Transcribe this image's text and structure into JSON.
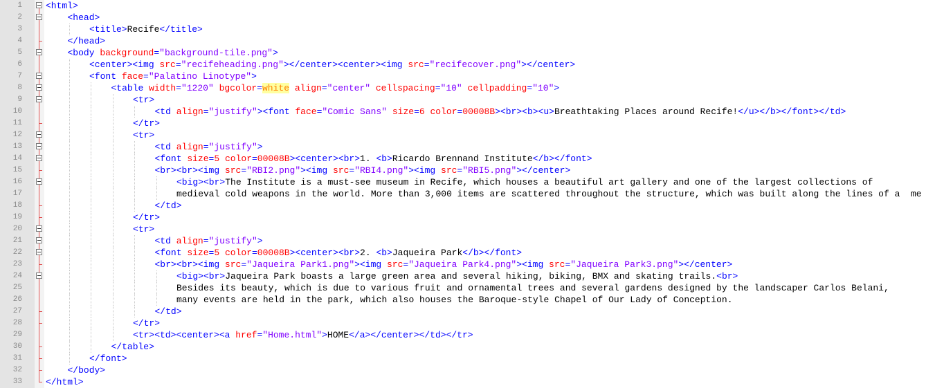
{
  "editor": {
    "colors": {
      "tag": "#0000ff",
      "attribute": "#ff0000",
      "string_value": "#8000ff",
      "unquoted_value": "#ff8000",
      "text": "#000000",
      "line_number": "#8a8a8a",
      "gutter_bg": "#e4e4e4"
    },
    "lines": [
      {
        "n": "1",
        "fold": "box-start",
        "indent": 0,
        "tokens": [
          {
            "t": "<html>",
            "c": "tg"
          }
        ]
      },
      {
        "n": "2",
        "fold": "box",
        "indent": 1,
        "tokens": [
          {
            "t": "<head>",
            "c": "tg"
          }
        ]
      },
      {
        "n": "3",
        "fold": "line",
        "indent": 2,
        "tokens": [
          {
            "t": "<title>",
            "c": "tg"
          },
          {
            "t": "Recife",
            "c": "tx"
          },
          {
            "t": "</title>",
            "c": "tg"
          }
        ]
      },
      {
        "n": "4",
        "fold": "tick",
        "indent": 1,
        "tokens": [
          {
            "t": "</head>",
            "c": "tg"
          }
        ]
      },
      {
        "n": "5",
        "fold": "box",
        "indent": 1,
        "tokens": [
          {
            "t": "<body ",
            "c": "tg"
          },
          {
            "t": "background",
            "c": "at"
          },
          {
            "t": "=",
            "c": "tg"
          },
          {
            "t": "\"background-tile.png\"",
            "c": "sv"
          },
          {
            "t": ">",
            "c": "tg"
          }
        ]
      },
      {
        "n": "6",
        "fold": "line",
        "indent": 2,
        "tokens": [
          {
            "t": "<center><img ",
            "c": "tg"
          },
          {
            "t": "src",
            "c": "at"
          },
          {
            "t": "=",
            "c": "tg"
          },
          {
            "t": "\"recifeheading.png\"",
            "c": "sv"
          },
          {
            "t": "></center><center><img ",
            "c": "tg"
          },
          {
            "t": "src",
            "c": "at"
          },
          {
            "t": "=",
            "c": "tg"
          },
          {
            "t": "\"recifecover.png\"",
            "c": "sv"
          },
          {
            "t": "></center>",
            "c": "tg"
          }
        ]
      },
      {
        "n": "7",
        "fold": "box",
        "indent": 2,
        "tokens": [
          {
            "t": "<font ",
            "c": "tg"
          },
          {
            "t": "face",
            "c": "at"
          },
          {
            "t": "=",
            "c": "tg"
          },
          {
            "t": "\"Palatino Linotype\"",
            "c": "sv"
          },
          {
            "t": ">",
            "c": "tg"
          }
        ]
      },
      {
        "n": "8",
        "fold": "box",
        "indent": 3,
        "tokens": [
          {
            "t": "<table ",
            "c": "tg"
          },
          {
            "t": "width",
            "c": "at"
          },
          {
            "t": "=",
            "c": "tg"
          },
          {
            "t": "\"1220\"",
            "c": "sv"
          },
          {
            "t": " ",
            "c": "tx"
          },
          {
            "t": "bgcolor",
            "c": "at"
          },
          {
            "t": "=",
            "c": "tg"
          },
          {
            "t": "white",
            "c": "ut"
          },
          {
            "t": " ",
            "c": "tx"
          },
          {
            "t": "align",
            "c": "at"
          },
          {
            "t": "=",
            "c": "tg"
          },
          {
            "t": "\"center\"",
            "c": "sv"
          },
          {
            "t": " ",
            "c": "tx"
          },
          {
            "t": "cellspacing",
            "c": "at"
          },
          {
            "t": "=",
            "c": "tg"
          },
          {
            "t": "\"10\"",
            "c": "sv"
          },
          {
            "t": " ",
            "c": "tx"
          },
          {
            "t": "cellpadding",
            "c": "at"
          },
          {
            "t": "=",
            "c": "tg"
          },
          {
            "t": "\"10\"",
            "c": "sv"
          },
          {
            "t": ">",
            "c": "tg"
          }
        ]
      },
      {
        "n": "9",
        "fold": "box",
        "indent": 4,
        "tokens": [
          {
            "t": "<tr>",
            "c": "tg"
          }
        ]
      },
      {
        "n": "10",
        "fold": "line",
        "indent": 5,
        "tokens": [
          {
            "t": "<td ",
            "c": "tg"
          },
          {
            "t": "align",
            "c": "at"
          },
          {
            "t": "=",
            "c": "tg"
          },
          {
            "t": "\"justify\"",
            "c": "sv"
          },
          {
            "t": "><font ",
            "c": "tg"
          },
          {
            "t": "face",
            "c": "at"
          },
          {
            "t": "=",
            "c": "tg"
          },
          {
            "t": "\"Comic Sans\"",
            "c": "sv"
          },
          {
            "t": " ",
            "c": "tx"
          },
          {
            "t": "size",
            "c": "at"
          },
          {
            "t": "=",
            "c": "tg"
          },
          {
            "t": "6",
            "c": "nm"
          },
          {
            "t": " ",
            "c": "tx"
          },
          {
            "t": "color",
            "c": "at"
          },
          {
            "t": "=",
            "c": "tg"
          },
          {
            "t": "00008B",
            "c": "nm"
          },
          {
            "t": "><br><b><u>",
            "c": "tg"
          },
          {
            "t": "Breathtaking Places around Recife!",
            "c": "tx"
          },
          {
            "t": "</u></b></font></td>",
            "c": "tg"
          }
        ]
      },
      {
        "n": "11",
        "fold": "tick",
        "indent": 4,
        "tokens": [
          {
            "t": "</tr>",
            "c": "tg"
          }
        ]
      },
      {
        "n": "12",
        "fold": "box",
        "indent": 4,
        "tokens": [
          {
            "t": "<tr>",
            "c": "tg"
          }
        ]
      },
      {
        "n": "13",
        "fold": "box",
        "indent": 5,
        "tokens": [
          {
            "t": "<td ",
            "c": "tg"
          },
          {
            "t": "align",
            "c": "at"
          },
          {
            "t": "=",
            "c": "tg"
          },
          {
            "t": "\"justify\"",
            "c": "sv"
          },
          {
            "t": ">",
            "c": "tg"
          }
        ]
      },
      {
        "n": "14",
        "fold": "box",
        "indent": 5,
        "tokens": [
          {
            "t": "<font ",
            "c": "tg"
          },
          {
            "t": "size",
            "c": "at"
          },
          {
            "t": "=",
            "c": "tg"
          },
          {
            "t": "5",
            "c": "nm"
          },
          {
            "t": " ",
            "c": "tx"
          },
          {
            "t": "color",
            "c": "at"
          },
          {
            "t": "=",
            "c": "tg"
          },
          {
            "t": "00008B",
            "c": "nm"
          },
          {
            "t": "><center><br>",
            "c": "tg"
          },
          {
            "t": "1. ",
            "c": "tx"
          },
          {
            "t": "<b>",
            "c": "tg"
          },
          {
            "t": "Ricardo Brennand Institute",
            "c": "tx"
          },
          {
            "t": "</b></font>",
            "c": "tg"
          }
        ]
      },
      {
        "n": "15",
        "fold": "tick",
        "indent": 5,
        "tokens": [
          {
            "t": "<br><br><img ",
            "c": "tg"
          },
          {
            "t": "src",
            "c": "at"
          },
          {
            "t": "=",
            "c": "tg"
          },
          {
            "t": "\"RBI2.png\"",
            "c": "sv"
          },
          {
            "t": "><img ",
            "c": "tg"
          },
          {
            "t": "src",
            "c": "at"
          },
          {
            "t": "=",
            "c": "tg"
          },
          {
            "t": "\"RBI4.png\"",
            "c": "sv"
          },
          {
            "t": "><img ",
            "c": "tg"
          },
          {
            "t": "src",
            "c": "at"
          },
          {
            "t": "=",
            "c": "tg"
          },
          {
            "t": "\"RBI5.png\"",
            "c": "sv"
          },
          {
            "t": "></center>",
            "c": "tg"
          }
        ]
      },
      {
        "n": "16",
        "fold": "box",
        "indent": 6,
        "tokens": [
          {
            "t": "<big><br>",
            "c": "tg"
          },
          {
            "t": "The Institute is a must-see museum in Recife, which houses a beautiful art gallery and one of the largest collections of",
            "c": "tx"
          }
        ]
      },
      {
        "n": "17",
        "fold": "line",
        "indent": 6,
        "tokens": [
          {
            "t": "medieval cold weapons in the world. More than 3,000 items are scattered throughout the structure, which was built along the lines of a  me",
            "c": "tx"
          }
        ]
      },
      {
        "n": "18",
        "fold": "tick",
        "indent": 5,
        "tokens": [
          {
            "t": "</td>",
            "c": "tg"
          }
        ]
      },
      {
        "n": "19",
        "fold": "tick",
        "indent": 4,
        "tokens": [
          {
            "t": "</tr>",
            "c": "tg"
          }
        ]
      },
      {
        "n": "20",
        "fold": "box",
        "indent": 4,
        "tokens": [
          {
            "t": "<tr>",
            "c": "tg"
          }
        ]
      },
      {
        "n": "21",
        "fold": "box",
        "indent": 5,
        "tokens": [
          {
            "t": "<td ",
            "c": "tg"
          },
          {
            "t": "align",
            "c": "at"
          },
          {
            "t": "=",
            "c": "tg"
          },
          {
            "t": "\"justify\"",
            "c": "sv"
          },
          {
            "t": ">",
            "c": "tg"
          }
        ]
      },
      {
        "n": "22",
        "fold": "box",
        "indent": 5,
        "tokens": [
          {
            "t": "<font ",
            "c": "tg"
          },
          {
            "t": "size",
            "c": "at"
          },
          {
            "t": "=",
            "c": "tg"
          },
          {
            "t": "5",
            "c": "nm"
          },
          {
            "t": " ",
            "c": "tx"
          },
          {
            "t": "color",
            "c": "at"
          },
          {
            "t": "=",
            "c": "tg"
          },
          {
            "t": "00008B",
            "c": "nm"
          },
          {
            "t": "><center><br>",
            "c": "tg"
          },
          {
            "t": "2. ",
            "c": "tx"
          },
          {
            "t": "<b>",
            "c": "tg"
          },
          {
            "t": "Jaqueira Park",
            "c": "tx"
          },
          {
            "t": "</b></font>",
            "c": "tg"
          }
        ]
      },
      {
        "n": "23",
        "fold": "tick",
        "indent": 5,
        "tokens": [
          {
            "t": "<br><br><img ",
            "c": "tg"
          },
          {
            "t": "src",
            "c": "at"
          },
          {
            "t": "=",
            "c": "tg"
          },
          {
            "t": "\"Jaqueira Park1.png\"",
            "c": "sv"
          },
          {
            "t": "><img ",
            "c": "tg"
          },
          {
            "t": "src",
            "c": "at"
          },
          {
            "t": "=",
            "c": "tg"
          },
          {
            "t": "\"Jaqueira Park4.png\"",
            "c": "sv"
          },
          {
            "t": "><img ",
            "c": "tg"
          },
          {
            "t": "src",
            "c": "at"
          },
          {
            "t": "=",
            "c": "tg"
          },
          {
            "t": "\"Jaqueira Park3.png\"",
            "c": "sv"
          },
          {
            "t": "></center>",
            "c": "tg"
          }
        ]
      },
      {
        "n": "24",
        "fold": "box",
        "indent": 6,
        "tokens": [
          {
            "t": "<big><br>",
            "c": "tg"
          },
          {
            "t": "Jaqueira Park boasts a large green area and several hiking, biking, BMX and skating trails.",
            "c": "tx"
          },
          {
            "t": "<br>",
            "c": "tg"
          }
        ]
      },
      {
        "n": "25",
        "fold": "line",
        "indent": 6,
        "tokens": [
          {
            "t": "Besides its beauty, which is due to various fruit and ornamental trees and several gardens designed by the landscaper Carlos Belani,",
            "c": "tx"
          }
        ]
      },
      {
        "n": "26",
        "fold": "line",
        "indent": 6,
        "tokens": [
          {
            "t": "many events are held in the park, which also houses the Baroque-style Chapel of Our Lady of Conception.",
            "c": "tx"
          }
        ]
      },
      {
        "n": "27",
        "fold": "tick",
        "indent": 5,
        "tokens": [
          {
            "t": "</td>",
            "c": "tg"
          }
        ]
      },
      {
        "n": "28",
        "fold": "tick",
        "indent": 4,
        "tokens": [
          {
            "t": "</tr>",
            "c": "tg"
          }
        ]
      },
      {
        "n": "29",
        "fold": "line",
        "indent": 4,
        "tokens": [
          {
            "t": "<tr><td><center><a ",
            "c": "tg"
          },
          {
            "t": "href",
            "c": "at"
          },
          {
            "t": "=",
            "c": "tg"
          },
          {
            "t": "\"Home.html\"",
            "c": "sv"
          },
          {
            "t": ">",
            "c": "tg"
          },
          {
            "t": "HOME",
            "c": "tx"
          },
          {
            "t": "</a></center></td></tr>",
            "c": "tg"
          }
        ]
      },
      {
        "n": "30",
        "fold": "tick",
        "indent": 3,
        "tokens": [
          {
            "t": "</table>",
            "c": "tg"
          }
        ]
      },
      {
        "n": "31",
        "fold": "tick",
        "indent": 2,
        "tokens": [
          {
            "t": "</font>",
            "c": "tg"
          }
        ]
      },
      {
        "n": "32",
        "fold": "tick",
        "indent": 1,
        "tokens": [
          {
            "t": "</body>",
            "c": "tg"
          }
        ]
      },
      {
        "n": "33",
        "fold": "end",
        "indent": 0,
        "tokens": [
          {
            "t": "</html>",
            "c": "tg"
          }
        ]
      }
    ]
  }
}
